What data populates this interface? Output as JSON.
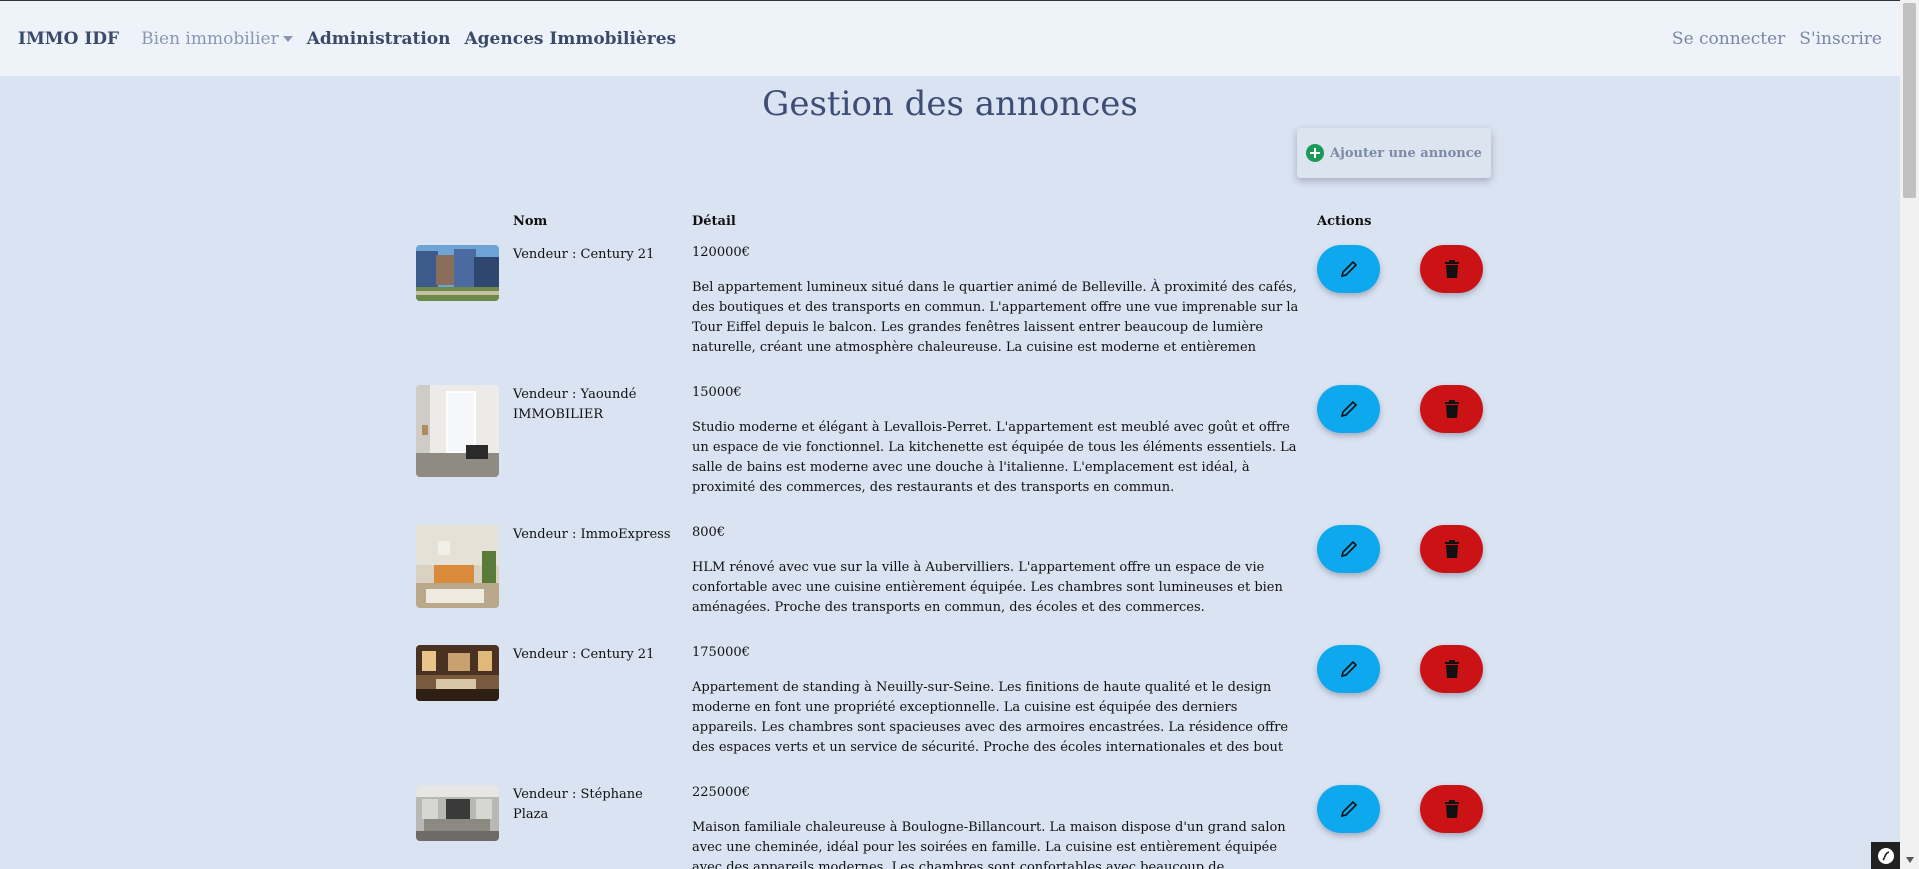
{
  "nav": {
    "brand": "IMMO IDF",
    "links": [
      "Bien immobilier",
      "Administration",
      "Agences Immobilières"
    ],
    "login": "Se connecter",
    "register": "S'inscrire"
  },
  "page": {
    "title": "Gestion des annonces",
    "add_label": "Ajouter une annonce"
  },
  "table": {
    "headers": {
      "name": "Nom",
      "detail": "Détail",
      "actions": "Actions"
    },
    "rows": [
      {
        "seller": "Vendeur : Century 21",
        "price": "120000€",
        "description": "Bel appartement lumineux situé dans le quartier animé de Belleville. À proximité des cafés, des boutiques et des transports en commun. L'appartement offre une vue imprenable sur la Tour Eiffel depuis le balcon. Les grandes fenêtres laissent entrer beaucoup de lumière naturelle, créant une atmosphère chaleureuse. La cuisine est moderne et entièremen",
        "image": "city-apartment-building"
      },
      {
        "seller": "Vendeur : Yaoundé IMMOBILIER",
        "price": "15000€",
        "description": "Studio moderne et élégant à Levallois-Perret. L'appartement est meublé avec goût et offre un espace de vie fonctionnel. La kitchenette est équipée de tous les éléments essentiels. La salle de bains est moderne avec une douche à l'italienne. L'emplacement est idéal, à proximité des commerces, des restaurants et des transports en commun.",
        "image": "white-studio-interior"
      },
      {
        "seller": "Vendeur : ImmoExpress",
        "price": "800€",
        "description": "HLM rénové avec vue sur la ville à Aubervilliers. L'appartement offre un espace de vie confortable avec une cuisine entièrement équipée. Les chambres sont lumineuses et bien aménagées. Proche des transports en commun, des écoles et des commerces.",
        "image": "living-room-orange-sofa"
      },
      {
        "seller": "Vendeur : Century 21",
        "price": "175000€",
        "description": "Appartement de standing à Neuilly-sur-Seine. Les finitions de haute qualité et le design moderne en font une propriété exceptionnelle. La cuisine est équipée des derniers appareils. Les chambres sont spacieuses avec des armoires encastrées. La résidence offre des espaces verts et un service de sécurité. Proche des écoles internationales et des bout",
        "image": "warm-lit-living-room"
      },
      {
        "seller": "Vendeur : Stéphane Plaza",
        "price": "225000€",
        "description": "Maison familiale chaleureuse à Boulogne-Billancourt. La maison dispose d'un grand salon avec une cheminée, idéal pour les soirées en famille. La cuisine est entièrement équipée avec des appareils modernes. Les chambres sont confortables avec beaucoup de rangement. Le jardin privé est parfait",
        "image": "grey-living-room"
      }
    ]
  },
  "icons": {
    "add": "plus-circle-icon",
    "edit": "pencil-icon",
    "delete": "trash-icon",
    "debug": "symfony-icon"
  },
  "colors": {
    "edit": "#0ea8ee",
    "delete": "#cb1316",
    "background": "#dae3f1",
    "navbar": "#eef3f9"
  }
}
